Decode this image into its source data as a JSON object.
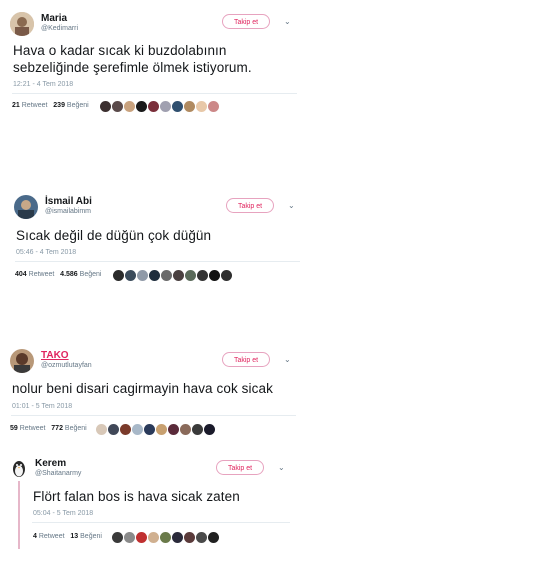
{
  "follow_label": "Takip et",
  "tweets": [
    {
      "name": "Maria",
      "handle": "@Kedimarri",
      "text_lines": [
        "Hava o kadar sıcak ki buzdolabının",
        "sebzeliğinde şerefimle ölmek istiyorum."
      ],
      "time": "12:21 - 4 Tem 2018",
      "retweets": "21",
      "retweet_label": "Retweet",
      "likes": "239",
      "likes_label": "Beğeni",
      "liker_colors": [
        "#3b2f2f",
        "#5a4a4a",
        "#c9a27e",
        "#1a1a1a",
        "#7a2e3a",
        "#a0a0b0",
        "#2f4f6f",
        "#b08a60",
        "#e8c8a8",
        "#cc8888"
      ]
    },
    {
      "name": "İsmail Abi",
      "handle": "@ismailabimm",
      "text_lines": [
        "Sıcak değil de düğün çok düğün"
      ],
      "time": "05:46 - 4 Tem 2018",
      "retweets": "404",
      "retweet_label": "Retweet",
      "likes": "4.586",
      "likes_label": "Beğeni",
      "liker_colors": [
        "#2a2a2a",
        "#3b4b5b",
        "#909aa8",
        "#1e2d3d",
        "#6a6a6a",
        "#4a4040",
        "#5a6a5a",
        "#333333",
        "#111111",
        "#2e2e2e"
      ]
    },
    {
      "name": "TAKO",
      "handle": "@ozmutlutayfan",
      "text_lines": [
        "nolur beni disari cagirmayin hava cok sicak"
      ],
      "time": "01:01 - 5 Tem 2018",
      "retweets": "59",
      "retweet_label": "Retweet",
      "likes": "772",
      "likes_label": "Beğeni",
      "liker_colors": [
        "#d8c8b8",
        "#404858",
        "#7a3a2a",
        "#a8b8c8",
        "#2a3a5a",
        "#c8a070",
        "#5a2a3a",
        "#8a6a5a",
        "#3a3a3a",
        "#1a1a2a"
      ]
    },
    {
      "name": "Kerem",
      "handle": "@Shaitanarmy",
      "text_lines": [
        "Flört falan bos is hava sicak zaten"
      ],
      "time": "05:04 - 5 Tem 2018",
      "retweets": "4",
      "retweet_label": "Retweet",
      "likes": "13",
      "likes_label": "Beğeni",
      "liker_colors": [
        "#3a3a3a",
        "#8a8a8a",
        "#c03030",
        "#d0b090",
        "#6a7a4a",
        "#2a2a3a",
        "#5a3a3a",
        "#4a4a4a",
        "#202020"
      ]
    }
  ]
}
